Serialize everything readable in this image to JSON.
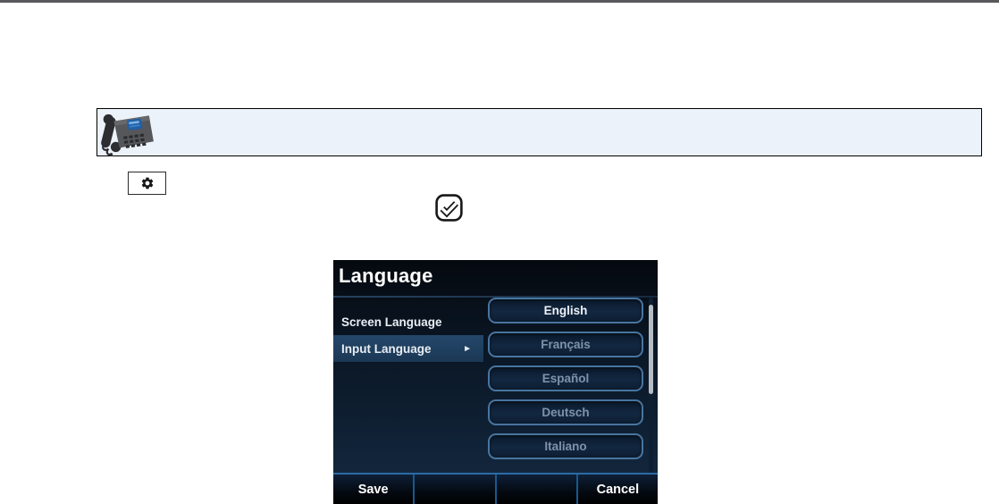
{
  "document": {
    "top_rule_color": "#58595b",
    "note_box": {
      "bg_color": "#ecf2f9",
      "image": "ip-desk-phone-photo"
    },
    "inline_keys": [
      {
        "name": "settings-key",
        "icon": "gear"
      },
      {
        "name": "ok-key",
        "icon": "checkmark"
      }
    ]
  },
  "phone_ui": {
    "title": "Language",
    "menu_items": [
      {
        "label": "Screen Language",
        "selected": false,
        "arrow": ""
      },
      {
        "label": "Input Language",
        "selected": true,
        "arrow": "►"
      }
    ],
    "language_options": [
      {
        "label": "English",
        "active": true
      },
      {
        "label": "Français",
        "active": false
      },
      {
        "label": "Español",
        "active": false
      },
      {
        "label": "Deutsch",
        "active": false
      },
      {
        "label": "Italiano",
        "active": false
      }
    ],
    "softkeys": [
      {
        "label": "Save"
      },
      {
        "label": ""
      },
      {
        "label": ""
      },
      {
        "label": "Cancel"
      }
    ],
    "colors": {
      "screen_bg": "#0d1b2c",
      "highlight_row": "#1e3c5c",
      "button_border": "#48759f",
      "active_text": "#edf1f5",
      "inactive_text": "#7e93a9",
      "softkey_divider": "#17598f",
      "softkey_top_rule": "#2a6ca5",
      "scroll_thumb": "#b5bcc4"
    }
  }
}
